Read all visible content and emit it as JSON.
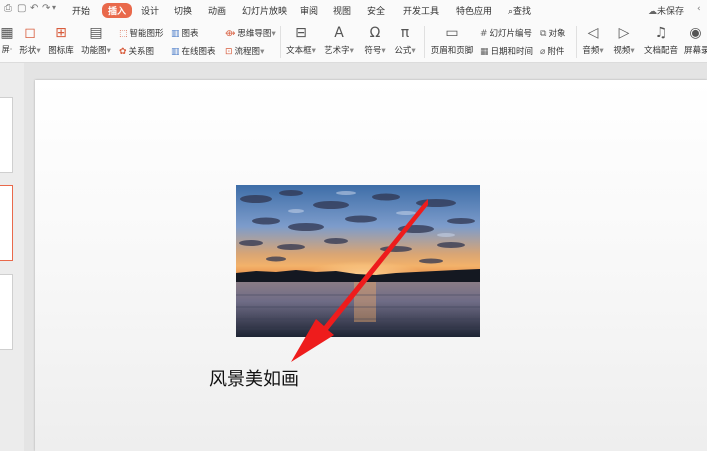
{
  "menubar": {
    "tabs": [
      "开始",
      "插入",
      "设计",
      "切换",
      "动画",
      "幻灯片放映",
      "审阅",
      "视图",
      "安全",
      "开发工具",
      "特色应用"
    ],
    "active_tab": "插入",
    "search_label": "查找",
    "save_status": "未保存"
  },
  "ribbon": {
    "shapes_label": "形状",
    "icon_lib_label": "图标库",
    "feature_chart_label": "功能图",
    "smart_shape_label": "智能图形",
    "chart_label": "图表",
    "mindmap_label": "思维导图",
    "relation_label": "关系图",
    "online_chart_label": "在线图表",
    "flowchart_label": "流程图",
    "textbox_label": "文本框",
    "wordart_label": "艺术字",
    "symbol_label": "符号",
    "formula_label": "公式",
    "header_footer_label": "页眉和页脚",
    "slide_number_label": "幻灯片编号",
    "object_label": "对象",
    "date_time_label": "日期和时间",
    "attachment_label": "附件",
    "audio_label": "音频",
    "video_label": "视频",
    "doc_dub_label": "文档配音",
    "screen_record_label": "屏幕录"
  },
  "slide": {
    "caption": "风景美如画"
  },
  "colors": {
    "accent": "#e9694b",
    "arrow": "#ee1c1c"
  }
}
